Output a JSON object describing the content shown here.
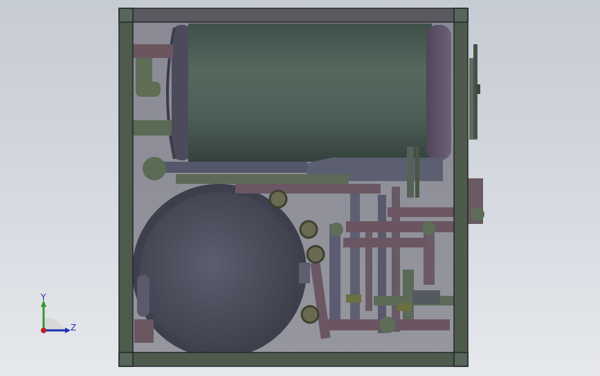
{
  "viewport": {
    "background_top": "#c6cbd4",
    "background_bottom": "#e6e8ec"
  },
  "model": {
    "frame_color": "#4d5b4c",
    "tank_color": "#4a5e57",
    "tank_end_color": "#5e5369",
    "compressor_color": "#525363",
    "pipe_color_a": "#6b5560",
    "pipe_color_b": "#58685a",
    "pipe_color_c": "#5a5f70"
  },
  "triad": {
    "y_label": "Y",
    "z_label": "Z",
    "y_color": "#2f9a2f",
    "z_color": "#1f2fb4",
    "x_color": "#c02020"
  }
}
